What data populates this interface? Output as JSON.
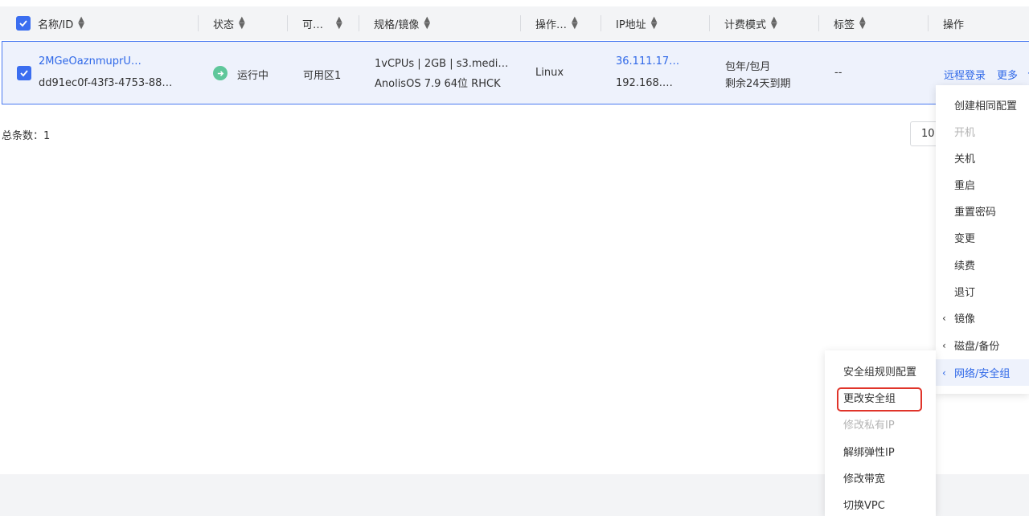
{
  "table": {
    "columns": [
      "名称/ID",
      "状态",
      "可…",
      "规格/镜像",
      "操作…",
      "IP地址",
      "计费模式",
      "标签",
      "操作"
    ],
    "row": {
      "name": "2MGeOaznmuprU…",
      "id": "dd91ec0f-43f3-4753-88…",
      "status": "运行中",
      "zone": "可用区1",
      "spec": "1vCPUs | 2GB | s3.medi…",
      "image": "AnolisOS 7.9 64位 RHCK",
      "os": "Linux",
      "ip_public": "36.111.17…",
      "ip_private": "192.168.…",
      "billing": "包年/包月",
      "billing_remaining": "剩余24天到期",
      "tag": "--",
      "action_login": "远程登录",
      "action_more": "更多"
    },
    "total_label": "总条数：1",
    "page_size": "10"
  },
  "more_menu": {
    "items": [
      {
        "label": "创建相同配置",
        "state": "normal"
      },
      {
        "label": "开机",
        "state": "disabled"
      },
      {
        "label": "关机",
        "state": "normal"
      },
      {
        "label": "重启",
        "state": "normal"
      },
      {
        "label": "重置密码",
        "state": "normal"
      },
      {
        "label": "变更",
        "state": "normal"
      },
      {
        "label": "续费",
        "state": "normal"
      },
      {
        "label": "退订",
        "state": "normal"
      },
      {
        "label": "镜像",
        "state": "submenu"
      },
      {
        "label": "磁盘/备份",
        "state": "submenu"
      },
      {
        "label": "网络/安全组",
        "state": "active"
      }
    ]
  },
  "network_submenu": {
    "items": [
      {
        "label": "安全组规则配置",
        "state": "normal"
      },
      {
        "label": "更改安全组",
        "state": "highlighted"
      },
      {
        "label": "修改私有IP",
        "state": "disabled"
      },
      {
        "label": "解绑弹性IP",
        "state": "normal"
      },
      {
        "label": "修改带宽",
        "state": "normal"
      },
      {
        "label": "切换VPC",
        "state": "normal"
      }
    ]
  },
  "colors": {
    "accent": "#2f68e8",
    "status_running": "#5fc79b",
    "highlight": "#e0342a"
  }
}
